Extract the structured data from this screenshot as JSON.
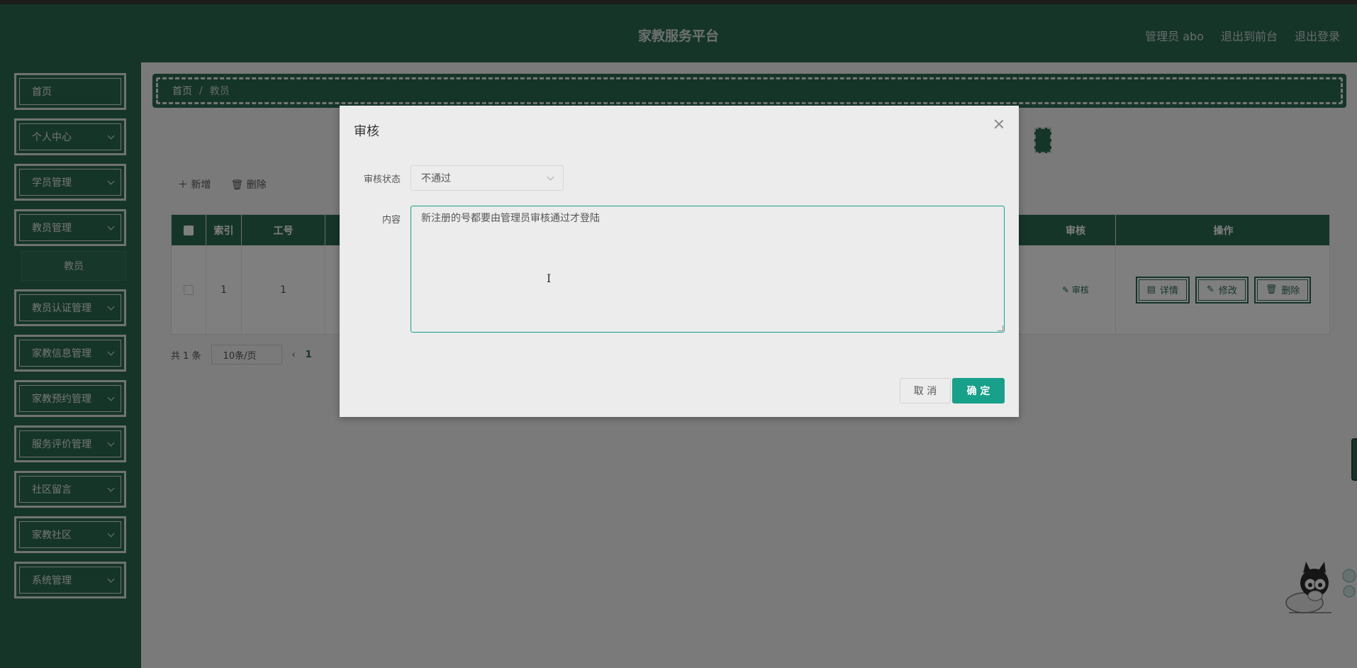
{
  "header": {
    "brand": "家教服务平台",
    "links": [
      "管理员 abo",
      "退出到前台",
      "退出登录"
    ]
  },
  "sidebar": {
    "items": [
      {
        "label": "首页",
        "expandable": false
      },
      {
        "label": "个人中心",
        "expandable": true
      },
      {
        "label": "学员管理",
        "expandable": true
      },
      {
        "label": "教员管理",
        "expandable": true
      },
      {
        "label": "教员认证管理",
        "expandable": true
      },
      {
        "label": "家教信息管理",
        "expandable": true
      },
      {
        "label": "家教预约管理",
        "expandable": true
      },
      {
        "label": "服务评价管理",
        "expandable": true
      },
      {
        "label": "社区留言",
        "expandable": true
      },
      {
        "label": "家教社区",
        "expandable": true
      },
      {
        "label": "系统管理",
        "expandable": true
      }
    ],
    "sub_item": "教员"
  },
  "breadcrumb": {
    "home": "首页",
    "sep": "/",
    "current": "教员"
  },
  "toolbar": {
    "add": "＋ 新增",
    "delete": "删除"
  },
  "table": {
    "headers": {
      "index": "索引",
      "job_no": "工号",
      "audit": "审核",
      "operation": "操作"
    },
    "row": {
      "index": "1",
      "job_no": "1",
      "audit": "审核",
      "detail": "详情",
      "edit": "修改",
      "delete": "删除"
    }
  },
  "pager": {
    "total": "共 1 条",
    "size": "10条/页",
    "current_page": "1"
  },
  "dialog": {
    "title": "审核",
    "status_label": "审核状态",
    "status_value": "不通过",
    "content_label": "内容",
    "content_value": "新注册的号都要由管理员审核通过才登陆",
    "cancel": "取 消",
    "confirm": "确 定"
  },
  "colors": {
    "brand_green": "#2d6a52",
    "accent_teal": "#17a08a"
  }
}
